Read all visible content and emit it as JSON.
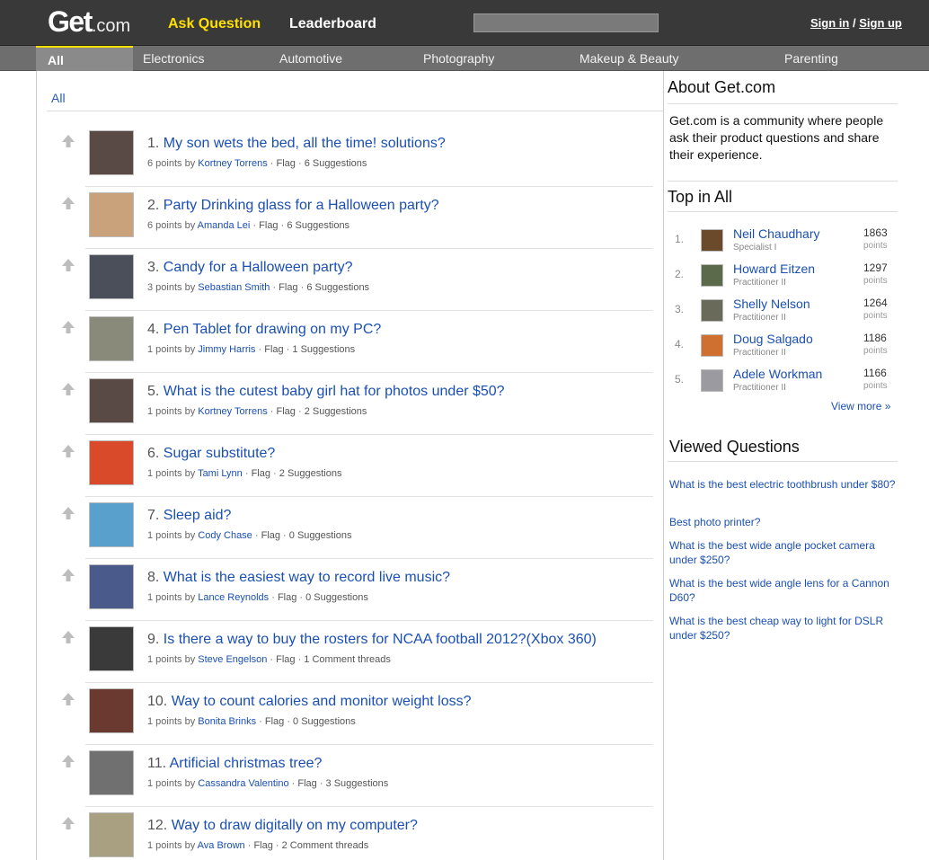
{
  "header": {
    "logo_main": "Get",
    "logo_suffix": ".com",
    "ask_question": "Ask Question",
    "leaderboard": "Leaderboard",
    "sign_in": "Sign in",
    "separator": "/",
    "sign_up": "Sign up"
  },
  "categories": {
    "all": "All",
    "items": [
      "Electronics",
      "Automotive",
      "Photography",
      "Makeup & Beauty",
      "Parenting"
    ]
  },
  "breadcrumb": "All",
  "questions": [
    {
      "num": "1.",
      "title": "My son wets the bed, all the time! solutions?",
      "points": "6 points by",
      "author": "Kortney Torrens",
      "flag": "Flag",
      "count": "6 Suggestions",
      "av": "#5a4a45"
    },
    {
      "num": "2.",
      "title": "Party Drinking glass for a Halloween party?",
      "points": "6 points by",
      "author": "Amanda Lei",
      "flag": "Flag",
      "count": "6 Suggestions",
      "av": "#c9a17a"
    },
    {
      "num": "3.",
      "title": "Candy for a Halloween party?",
      "points": "3 points by",
      "author": "Sebastian Smith",
      "flag": "Flag",
      "count": "6 Suggestions",
      "av": "#4b4f5a"
    },
    {
      "num": "4.",
      "title": "Pen Tablet for drawing on my PC?",
      "points": "1 points by",
      "author": "Jimmy Harris",
      "flag": "Flag",
      "count": "1 Suggestions",
      "av": "#8a8a7a"
    },
    {
      "num": "5.",
      "title": "What is the cutest baby girl hat for photos under $50?",
      "points": "1 points by",
      "author": "Kortney Torrens",
      "flag": "Flag",
      "count": "2 Suggestions",
      "av": "#5a4a45"
    },
    {
      "num": "6.",
      "title": "Sugar substitute?",
      "points": "1 points by",
      "author": "Tami Lynn",
      "flag": "Flag",
      "count": "2 Suggestions",
      "av": "#d84a2a"
    },
    {
      "num": "7.",
      "title": "Sleep aid?",
      "points": "1 points by",
      "author": "Cody Chase",
      "flag": "Flag",
      "count": "0 Suggestions",
      "av": "#5aa0cc"
    },
    {
      "num": "8.",
      "title": "What is the easiest way to record live music?",
      "points": "1 points by",
      "author": "Lance Reynolds",
      "flag": "Flag",
      "count": "0 Suggestions",
      "av": "#4a5a8a"
    },
    {
      "num": "9.",
      "title": "Is there a way to buy the rosters for NCAA football 2012?(Xbox 360)",
      "points": "1 points by",
      "author": "Steve Engelson",
      "flag": "Flag",
      "count": "1 Comment threads",
      "av": "#3a3a3a"
    },
    {
      "num": "10.",
      "title": "Way to count calories and monitor weight loss?",
      "points": "1 points by",
      "author": "Bonita Brinks",
      "flag": "Flag",
      "count": "0 Suggestions",
      "av": "#6a3a30"
    },
    {
      "num": "11.",
      "title": "Artificial christmas tree?",
      "points": "1 points by",
      "author": "Cassandra Valentino",
      "flag": "Flag",
      "count": "3 Suggestions",
      "av": "#707070"
    },
    {
      "num": "12.",
      "title": "Way to draw digitally on my computer?",
      "points": "1 points by",
      "author": "Ava Brown",
      "flag": "Flag",
      "count": "2 Comment threads",
      "av": "#a8a080"
    }
  ],
  "sidebar": {
    "about_title": "About Get.com",
    "about_text": "Get.com is a community where people ask their product questions and share their experience.",
    "top_title": "Top in All",
    "leaders": [
      {
        "rank": "1.",
        "name": "Neil Chaudhary",
        "title": "Specialist I",
        "points": "1863",
        "unit": "points",
        "av": "#6a4a2a"
      },
      {
        "rank": "2.",
        "name": "Howard Eitzen",
        "title": "Practitioner II",
        "points": "1297",
        "unit": "points",
        "av": "#5a6a4a"
      },
      {
        "rank": "3.",
        "name": "Shelly Nelson",
        "title": "Practitioner II",
        "points": "1264",
        "unit": "points",
        "av": "#6a6a5a"
      },
      {
        "rank": "4.",
        "name": "Doug Salgado",
        "title": "Practitioner II",
        "points": "1186",
        "unit": "points",
        "av": "#d07030"
      },
      {
        "rank": "5.",
        "name": "Adele Workman",
        "title": "Practitioner II",
        "points": "1166",
        "unit": "points",
        "av": "#9a9aa0"
      }
    ],
    "view_more": "View more »",
    "viewed_title": "Viewed Questions",
    "viewed": [
      "What is the best electric toothbrush under $80?",
      "Best photo printer?",
      "What is the best wide angle pocket camera under $250?",
      "What is the best wide angle lens for a Cannon D60?",
      "What is the best cheap way to light for DSLR under $250?"
    ]
  },
  "colors": {
    "accent": "#ffe000",
    "link": "#1a4fb4",
    "topbar": "#393939",
    "catbar": "#6e6e6e"
  }
}
